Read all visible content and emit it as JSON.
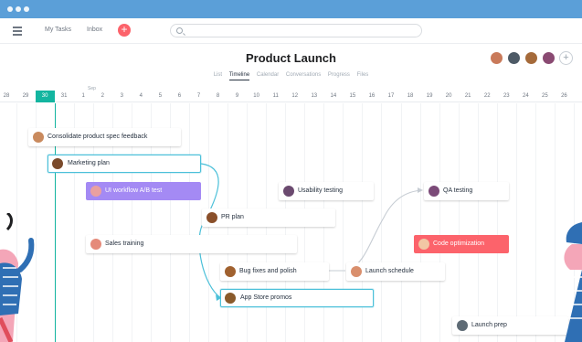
{
  "nav": {
    "my_tasks": "My Tasks",
    "inbox": "Inbox",
    "add_symbol": "+"
  },
  "header": {
    "title": "Product Launch",
    "add_member_symbol": "+"
  },
  "tabs": [
    "List",
    "Timeline",
    "Calendar",
    "Conversations",
    "Progress",
    "Files"
  ],
  "active_tab": "Timeline",
  "timeline": {
    "month_label": "Sep",
    "days": [
      "28",
      "29",
      "30",
      "31",
      "1",
      "2",
      "3",
      "4",
      "5",
      "6",
      "7",
      "8",
      "9",
      "10",
      "11",
      "12",
      "13",
      "14",
      "15",
      "16",
      "17",
      "18",
      "19",
      "20",
      "21",
      "22",
      "23",
      "24",
      "25",
      "26"
    ],
    "today": "30"
  },
  "tasks": [
    {
      "name": "Consolidate product spec feedback",
      "style": "default",
      "avatar": "#c98a5e"
    },
    {
      "name": "Marketing plan",
      "style": "selected",
      "avatar": "#7a4a2b"
    },
    {
      "name": "UI workflow A/B test",
      "style": "purple",
      "avatar": "#e9a0a0"
    },
    {
      "name": "Usability testing",
      "style": "default",
      "avatar": "#6b4a6f"
    },
    {
      "name": "QA testing",
      "style": "default",
      "avatar": "#7b4a78"
    },
    {
      "name": "PR plan",
      "style": "default",
      "avatar": "#8a4f2a"
    },
    {
      "name": "Sales training",
      "style": "default",
      "avatar": "#e58a7a"
    },
    {
      "name": "Code optimization",
      "style": "red",
      "avatar": "#f2c7a4"
    },
    {
      "name": "Bug fixes and polish",
      "style": "default",
      "avatar": "#a0612f"
    },
    {
      "name": "Launch schedule",
      "style": "default",
      "avatar": "#d98f6d"
    },
    {
      "name": "App Store promos",
      "style": "selected",
      "avatar": "#8a5a2b"
    },
    {
      "name": "Launch prep",
      "style": "default",
      "avatar": "#5e6b75"
    }
  ],
  "colors": {
    "accent_teal": "#13b5a0",
    "dependency_blue": "#4bc0d9",
    "purple_task": "#a48af4",
    "red_task": "#fc636b",
    "chrome_blue": "#5b9fd8"
  }
}
